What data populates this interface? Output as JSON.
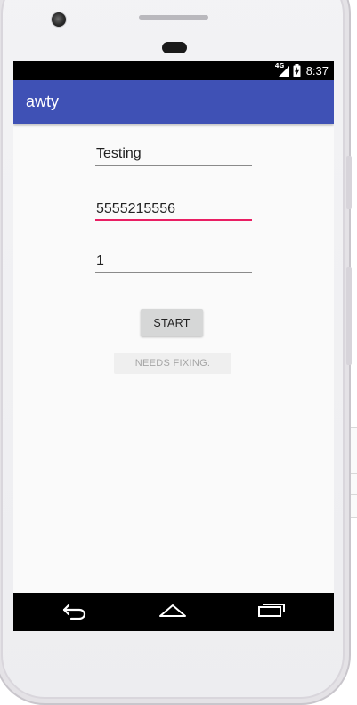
{
  "device": {
    "frame_color": "#f0eff2"
  },
  "status_bar": {
    "network": "4G",
    "time": "8:37"
  },
  "app_bar": {
    "title": "awty",
    "color": "#3f51b5"
  },
  "form": {
    "message_value": "Testing",
    "phone_value": "5555215556",
    "interval_value": "1",
    "focus_color": "#e91e63"
  },
  "buttons": {
    "start_label": "START",
    "needs_fixing_label": "NEEDS FIXING:"
  },
  "nav_bar": {
    "back_icon": "back-arrow-icon",
    "home_icon": "home-icon",
    "recents_icon": "recents-icon"
  }
}
